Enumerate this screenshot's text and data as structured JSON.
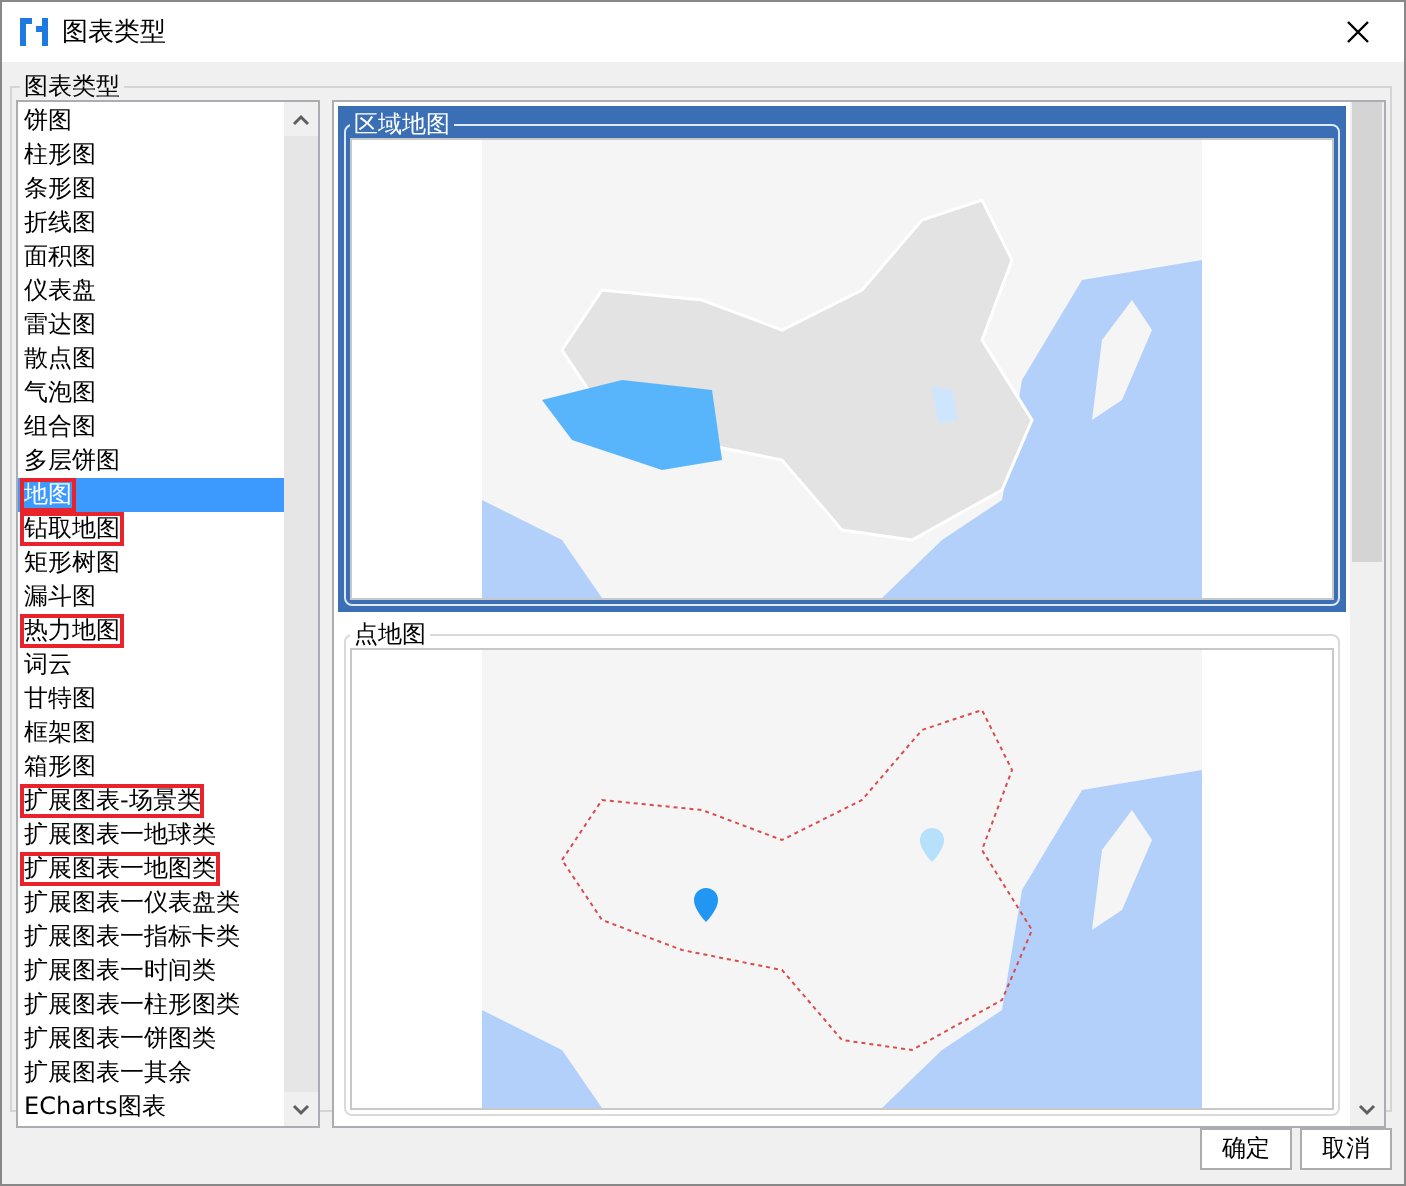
{
  "window": {
    "title": "图表类型"
  },
  "group": {
    "label": "图表类型"
  },
  "chart_types": [
    {
      "label": "饼图",
      "selected": false,
      "marked": false
    },
    {
      "label": "柱形图",
      "selected": false,
      "marked": false
    },
    {
      "label": "条形图",
      "selected": false,
      "marked": false
    },
    {
      "label": "折线图",
      "selected": false,
      "marked": false
    },
    {
      "label": "面积图",
      "selected": false,
      "marked": false
    },
    {
      "label": "仪表盘",
      "selected": false,
      "marked": false
    },
    {
      "label": "雷达图",
      "selected": false,
      "marked": false
    },
    {
      "label": "散点图",
      "selected": false,
      "marked": false
    },
    {
      "label": "气泡图",
      "selected": false,
      "marked": false
    },
    {
      "label": "组合图",
      "selected": false,
      "marked": false
    },
    {
      "label": "多层饼图",
      "selected": false,
      "marked": false
    },
    {
      "label": "地图",
      "selected": true,
      "marked": true
    },
    {
      "label": "钻取地图",
      "selected": false,
      "marked": true
    },
    {
      "label": "矩形树图",
      "selected": false,
      "marked": false
    },
    {
      "label": "漏斗图",
      "selected": false,
      "marked": false
    },
    {
      "label": "热力地图",
      "selected": false,
      "marked": true
    },
    {
      "label": "词云",
      "selected": false,
      "marked": false
    },
    {
      "label": "甘特图",
      "selected": false,
      "marked": false
    },
    {
      "label": "框架图",
      "selected": false,
      "marked": false
    },
    {
      "label": "箱形图",
      "selected": false,
      "marked": false
    },
    {
      "label": "扩展图表-场景类",
      "selected": false,
      "marked": true
    },
    {
      "label": "扩展图表一地球类",
      "selected": false,
      "marked": false
    },
    {
      "label": "扩展图表一地图类",
      "selected": false,
      "marked": true
    },
    {
      "label": "扩展图表一仪表盘类",
      "selected": false,
      "marked": false
    },
    {
      "label": "扩展图表一指标卡类",
      "selected": false,
      "marked": false
    },
    {
      "label": "扩展图表一时间类",
      "selected": false,
      "marked": false
    },
    {
      "label": "扩展图表一柱形图类",
      "selected": false,
      "marked": false
    },
    {
      "label": "扩展图表一饼图类",
      "selected": false,
      "marked": false
    },
    {
      "label": "扩展图表一其余",
      "selected": false,
      "marked": false
    },
    {
      "label": "ECharts图表",
      "selected": false,
      "marked": false
    }
  ],
  "previews": [
    {
      "title": "区域地图",
      "kind": "region",
      "selected": true
    },
    {
      "title": "点地图",
      "kind": "point",
      "selected": false
    }
  ],
  "buttons": [
    "确定",
    "取消"
  ]
}
